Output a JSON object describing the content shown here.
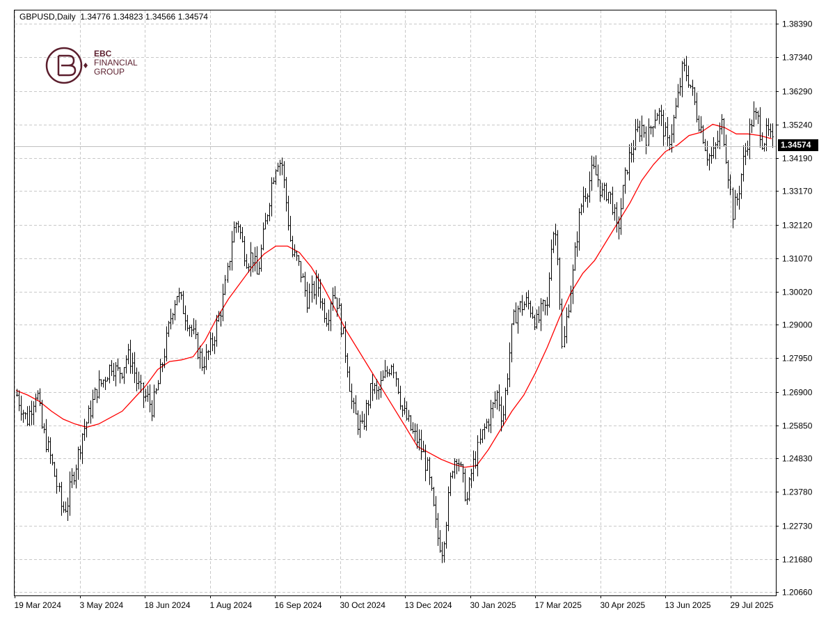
{
  "header": {
    "symbol": "GBPUSD,Daily",
    "open": "1.34776",
    "high": "1.34823",
    "low": "1.34566",
    "close": "1.34574"
  },
  "logo": {
    "line1": "EBC",
    "line2": "FINANCIAL",
    "line3": "GROUP",
    "color": "#5b1e2d"
  },
  "current_price": "1.34574",
  "chart_data": {
    "type": "bar",
    "subtype": "ohlc-bar",
    "y_ticks": [
      "1.38390",
      "1.37340",
      "1.36290",
      "1.35240",
      "1.34190",
      "1.33170",
      "1.32120",
      "1.31070",
      "1.30020",
      "1.29000",
      "1.27950",
      "1.26900",
      "1.25850",
      "1.24830",
      "1.23780",
      "1.22730",
      "1.21680",
      "1.20660"
    ],
    "x_ticks": [
      "19 Mar 2024",
      "3 May 2024",
      "18 Jun 2024",
      "1 Aug 2024",
      "16 Sep 2024",
      "30 Oct 2024",
      "13 Dec 2024",
      "30 Jan 2025",
      "17 Mar 2025",
      "30 Apr 2025",
      "13 Jun 2025",
      "29 Jul 2025"
    ],
    "ylim": [
      1.2066,
      1.3839
    ],
    "grid": true,
    "last_price_line": 1.34574,
    "series": [
      {
        "kind": "close_path",
        "color": "#000000",
        "values": [
          1.268,
          1.264,
          1.26,
          1.265,
          1.27,
          1.258,
          1.253,
          1.247,
          1.24,
          1.232,
          1.234,
          1.242,
          1.248,
          1.256,
          1.26,
          1.265,
          1.27,
          1.272,
          1.275,
          1.278,
          1.275,
          1.276,
          1.28,
          1.279,
          1.272,
          1.268,
          1.267,
          1.264,
          1.27,
          1.278,
          1.286,
          1.295,
          1.3,
          1.296,
          1.292,
          1.288,
          1.283,
          1.278,
          1.28,
          1.284,
          1.29,
          1.296,
          1.305,
          1.318,
          1.323,
          1.315,
          1.31,
          1.312,
          1.305,
          1.315,
          1.325,
          1.335,
          1.342,
          1.34,
          1.326,
          1.312,
          1.31,
          1.305,
          1.298,
          1.3,
          1.303,
          1.296,
          1.292,
          1.301,
          1.297,
          1.288,
          1.278,
          1.264,
          1.26,
          1.257,
          1.265,
          1.271,
          1.268,
          1.272,
          1.275,
          1.279,
          1.272,
          1.263,
          1.26,
          1.256,
          1.254,
          1.25,
          1.245,
          1.235,
          1.224,
          1.22,
          1.232,
          1.246,
          1.25,
          1.242,
          1.235,
          1.245,
          1.25,
          1.256,
          1.26,
          1.264,
          1.269,
          1.26,
          1.275,
          1.29,
          1.295,
          1.296,
          1.297,
          1.294,
          1.29,
          1.295,
          1.295,
          1.32,
          1.317,
          1.28,
          1.295,
          1.305,
          1.32,
          1.33,
          1.333,
          1.338,
          1.336,
          1.33,
          1.332,
          1.328,
          1.318,
          1.33,
          1.34,
          1.345,
          1.35,
          1.352,
          1.348,
          1.354,
          1.357,
          1.352,
          1.346,
          1.352,
          1.36,
          1.37,
          1.368,
          1.362,
          1.355,
          1.35,
          1.343,
          1.342,
          1.347,
          1.353,
          1.34,
          1.325,
          1.33,
          1.34,
          1.348,
          1.355,
          1.354,
          1.347,
          1.35,
          1.346
        ]
      },
      {
        "kind": "moving_average",
        "color": "#ff0000",
        "values": [
          1.2695,
          1.268,
          1.266,
          1.263,
          1.2605,
          1.259,
          1.258,
          1.259,
          1.261,
          1.263,
          1.267,
          1.271,
          1.276,
          1.2785,
          1.279,
          1.28,
          1.285,
          1.292,
          1.298,
          1.303,
          1.308,
          1.312,
          1.3145,
          1.3145,
          1.3125,
          1.308,
          1.302,
          1.295,
          1.288,
          1.282,
          1.276,
          1.27,
          1.264,
          1.258,
          1.252,
          1.25,
          1.248,
          1.2465,
          1.2455,
          1.246,
          1.251,
          1.257,
          1.263,
          1.268,
          1.275,
          1.283,
          1.292,
          1.3,
          1.306,
          1.31,
          1.316,
          1.322,
          1.328,
          1.335,
          1.34,
          1.344,
          1.346,
          1.349,
          1.35,
          1.3525,
          1.3515,
          1.3495,
          1.3495,
          1.349,
          1.348
        ]
      }
    ]
  }
}
